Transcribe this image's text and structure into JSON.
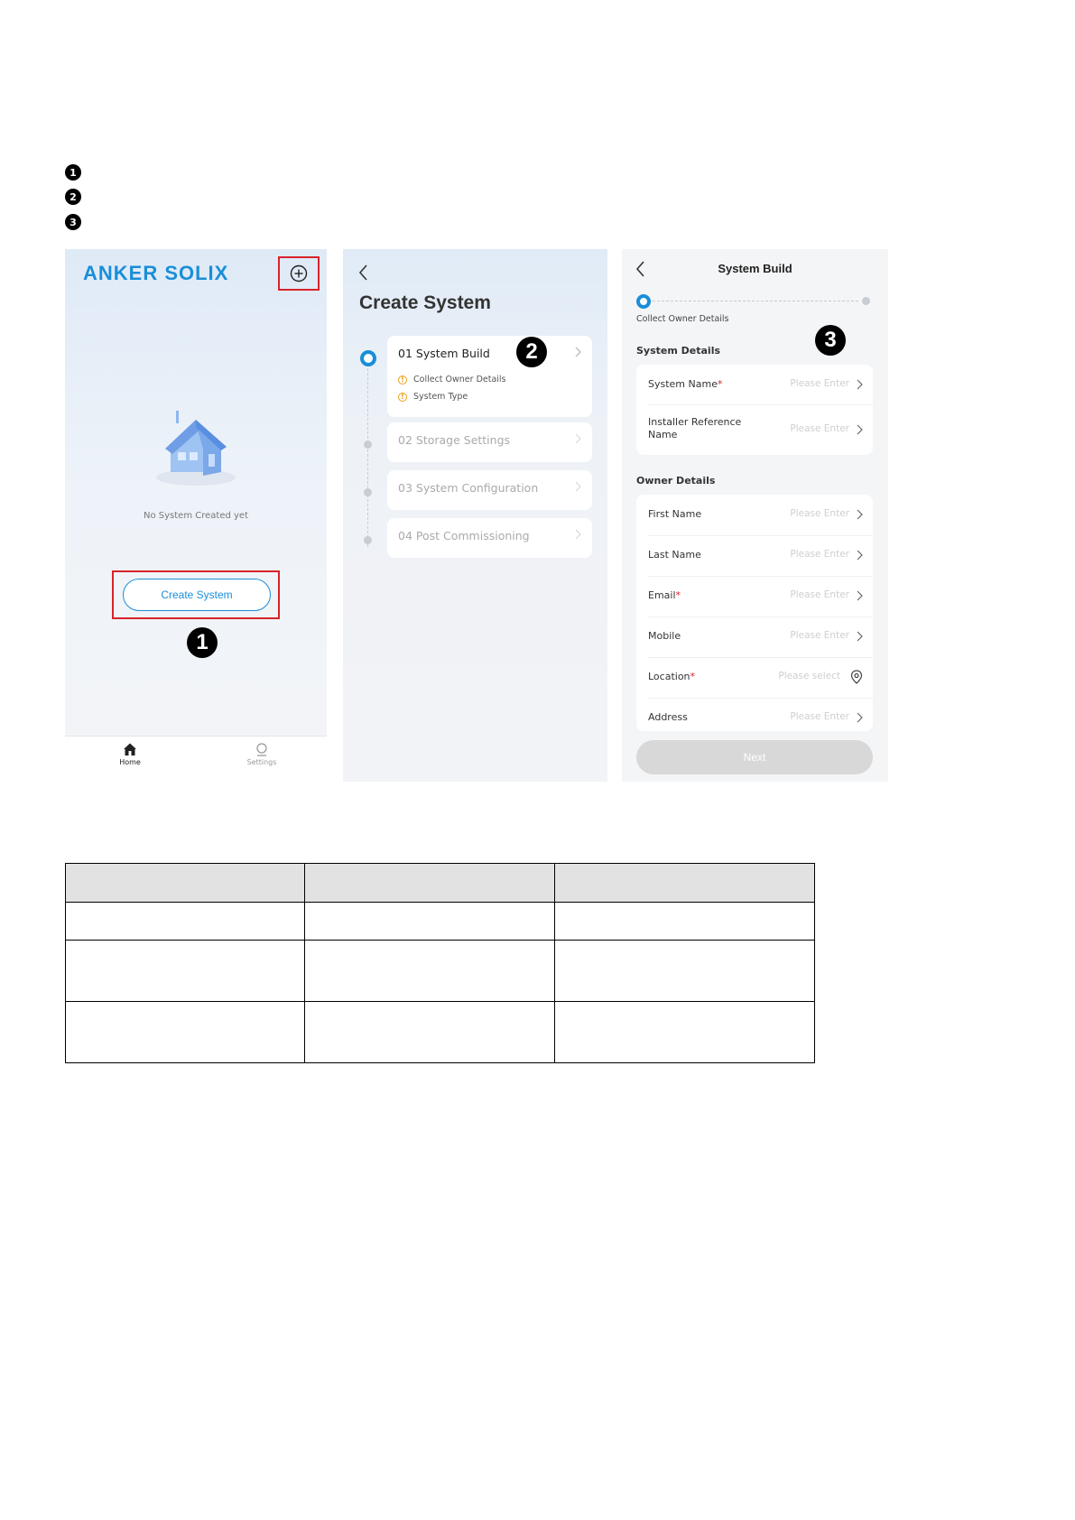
{
  "bullets": [
    "1",
    "2",
    "3"
  ],
  "screen1": {
    "brand": "ANKER SOLIX",
    "empty_text": "No System Created yet",
    "create_button": "Create System",
    "callout": "1",
    "nav": [
      {
        "label": "Home",
        "icon": "home-icon"
      },
      {
        "label": "Settings",
        "icon": "settings-icon"
      }
    ]
  },
  "screen2": {
    "title": "Create System",
    "callout": "2",
    "steps": [
      {
        "label": "01 System Build",
        "subitems": [
          "Collect Owner Details",
          "System Type"
        ]
      },
      {
        "label": "02 Storage Settings"
      },
      {
        "label": "03 System Configuration"
      },
      {
        "label": "04 Post Commissioning"
      }
    ]
  },
  "screen3": {
    "title": "System Build",
    "progress_label": "Collect Owner Details",
    "callout": "3",
    "system_details_title": "System Details",
    "system_rows": [
      {
        "label": "System Name",
        "required": "*",
        "value": "Please Enter"
      },
      {
        "label_line1": "Installer Reference",
        "label_line2": "Name",
        "value": "Please Enter"
      }
    ],
    "owner_details_title": "Owner Details",
    "owner_rows": [
      {
        "label": "First Name",
        "required": "",
        "value": "Please Enter"
      },
      {
        "label": "Last Name",
        "required": "",
        "value": "Please Enter"
      },
      {
        "label": "Email",
        "required": "*",
        "value": "Please Enter"
      },
      {
        "label": "Mobile",
        "required": "",
        "value": "Please Enter"
      },
      {
        "label": "Location",
        "required": "*",
        "value": "Please select"
      },
      {
        "label": "Address",
        "required": "",
        "value": "Please Enter"
      }
    ],
    "next_button": "Next"
  },
  "colors": {
    "accent": "#1a8ed8",
    "highlight": "#d8232a",
    "warning": "#e9a11a"
  }
}
